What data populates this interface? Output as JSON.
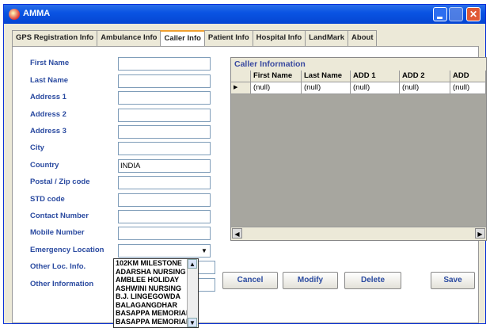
{
  "window": {
    "title": "AMMA"
  },
  "tabs": [
    "GPS Registration Info",
    "Ambulance Info",
    "Caller Info",
    "Patient Info",
    "Hospital Info",
    "LandMark",
    "About"
  ],
  "active_tab": "Caller Info",
  "form": {
    "fields": [
      {
        "label": "First Name",
        "value": ""
      },
      {
        "label": "Last Name",
        "value": ""
      },
      {
        "label": "Address 1",
        "value": ""
      },
      {
        "label": "Address 2",
        "value": ""
      },
      {
        "label": "Address 3",
        "value": ""
      },
      {
        "label": "City",
        "value": ""
      },
      {
        "label": "Country",
        "value": "INDIA"
      },
      {
        "label": "Postal / Zip code",
        "value": ""
      },
      {
        "label": "STD code",
        "value": ""
      },
      {
        "label": "Contact Number",
        "value": ""
      },
      {
        "label": "Mobile Number",
        "value": ""
      },
      {
        "label": "Emergency Location",
        "value": ""
      },
      {
        "label": "Other Loc. Info.",
        "value": ""
      },
      {
        "label": "Other Information",
        "value": ""
      }
    ]
  },
  "grid": {
    "title": "Caller Information",
    "columns": [
      "First Name",
      "Last Name",
      "ADD 1",
      "ADD 2",
      "ADD"
    ],
    "rows": [
      [
        "(null)",
        "(null)",
        "(null)",
        "(null)",
        "(null)"
      ]
    ]
  },
  "dropdown_options": [
    "102KM MILESTONE",
    "ADARSHA NURSING",
    "AMBLEE HOLIDAY",
    "ASHWINI NURSING",
    "B.J. LINGEGOWDA",
    "BALAGANGDHAR",
    "BASAPPA MEMORIAL",
    "BASAPPA MEMORIAL"
  ],
  "buttons": {
    "cancel": "Cancel",
    "modify": "Modify",
    "delete": "Delete",
    "save": "Save"
  },
  "colors": {
    "label": "#2a4aa0",
    "titlebar": "#0a54e3",
    "grid_bg": "#a7a69f"
  }
}
